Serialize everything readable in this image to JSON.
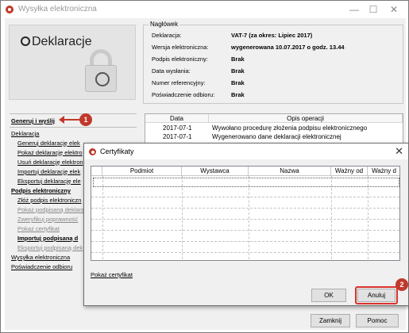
{
  "window": {
    "title": "Wysyłka elektroniczna",
    "minimize": "—",
    "maximize": "☐",
    "close": "✕"
  },
  "logo": {
    "text": "Deklaracje"
  },
  "header": {
    "legend": "Nagłówek",
    "rows": [
      {
        "label": "Deklaracja:",
        "value": "VAT-7 (za okres: Lipiec 2017)"
      },
      {
        "label": "Wersja elektroniczna:",
        "value": "wygenerowana 10.07.2017 o godz. 13.44"
      },
      {
        "label": "Podpis elektroniczny:",
        "value": "Brak"
      },
      {
        "label": "Data wysłania:",
        "value": "Brak"
      },
      {
        "label": "Numer referencyjny:",
        "value": "Brak"
      },
      {
        "label": "Poświadczenie odbioru:",
        "value": "Brak"
      }
    ]
  },
  "nav": {
    "generate": "Generuj i wyślij",
    "declaration": "Deklaracja",
    "declaration_items": [
      "Generuj deklarację elek",
      "Pokaż deklarację elektro",
      "Usuń deklarację elektron",
      "Importuj deklarację elek",
      "Eksportuj deklarację ele"
    ],
    "signature": "Podpis elektroniczny",
    "signature_items": [
      "Złóż podpis elektroniczn",
      "Pokaż podpisaną deklara",
      "Zweryfikuj poprawność",
      "Pokaż certyfikat",
      "Importuj podpisaną d",
      "Eksportuj podpisaną dek"
    ],
    "sending": "Wysyłka elektroniczna",
    "receipt": "Poświadczenie odbioru"
  },
  "operations": {
    "headers": [
      "Data",
      "Opis operacji"
    ],
    "rows": [
      {
        "date": "2017-07-1",
        "desc": "Wywołano procedurę złożenia podpisu elektronicznego"
      },
      {
        "date": "2017-07-1",
        "desc": "Wygenerowano dane deklaracji elektronicznej"
      }
    ]
  },
  "buttons": {
    "close": "Zamknij",
    "help": "Pomoc"
  },
  "dialog": {
    "title": "Certyfikaty",
    "close": "✕",
    "columns": [
      "Podmiot",
      "Wystawca",
      "Nazwa",
      "Ważny od",
      "Ważny d"
    ],
    "show_certificate": "Pokaż certyfikat",
    "ok": "OK",
    "cancel": "Anuluj"
  },
  "annotations": {
    "step1": "1",
    "step2": "2"
  },
  "colors": {
    "annotation": "#c0392b",
    "highlight": "#d9322b"
  }
}
